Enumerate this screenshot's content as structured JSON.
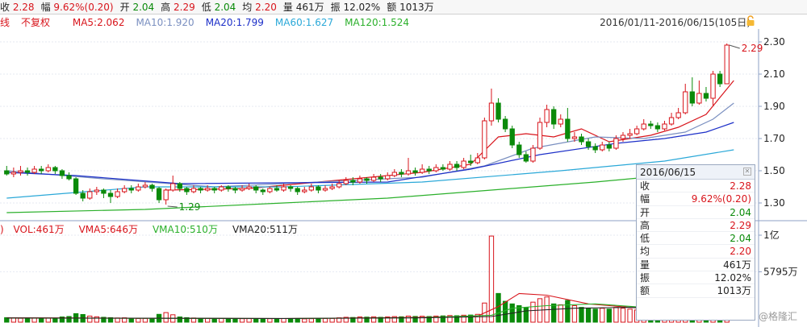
{
  "topbar": [
    {
      "label": "收",
      "value": "2.28",
      "tone": "red"
    },
    {
      "label": "幅",
      "value": "9.62%(0.20)",
      "tone": "red"
    },
    {
      "label": "开",
      "value": "2.04",
      "tone": "green"
    },
    {
      "label": "高",
      "value": "2.29",
      "tone": "red"
    },
    {
      "label": "低",
      "value": "2.04",
      "tone": "green"
    },
    {
      "label": "均",
      "value": "2.20",
      "tone": "red"
    },
    {
      "label": "量",
      "value": "461万",
      "tone": "dark"
    },
    {
      "label": "振",
      "value": "12.02%",
      "tone": "dark"
    },
    {
      "label": "额",
      "value": "1013万",
      "tone": "dark"
    }
  ],
  "ma_legend": {
    "prefix": "线",
    "mode": "不复权",
    "items": [
      {
        "text": "MA5:2.062",
        "color": "#d8141b"
      },
      {
        "text": "MA10:1.920",
        "color": "#7a8fc0"
      },
      {
        "text": "MA20:1.799",
        "color": "#1c2fc8"
      },
      {
        "text": "MA60:1.627",
        "color": "#2aa8d8"
      },
      {
        "text": "MA120:1.524",
        "color": "#2bb02b"
      }
    ]
  },
  "date_range": "2016/01/11-2016/06/15(105日)",
  "vol_legend": {
    "prefix": ")",
    "items": [
      {
        "text": "VOL:461万",
        "color": "#d8141b"
      },
      {
        "text": "VMA5:646万",
        "color": "#d8141b"
      },
      {
        "text": "VMA10:510万",
        "color": "#2bb02b"
      },
      {
        "text": "VMA20:511万",
        "color": "#222222"
      }
    ]
  },
  "infobox": {
    "date": "2016/06/15",
    "rows": [
      {
        "k": "收",
        "v": "2.28",
        "tone": "red"
      },
      {
        "k": "幅",
        "v": "9.62%(0.20)",
        "tone": "red"
      },
      {
        "k": "开",
        "v": "2.04",
        "tone": "green"
      },
      {
        "k": "高",
        "v": "2.29",
        "tone": "red"
      },
      {
        "k": "低",
        "v": "2.04",
        "tone": "green"
      },
      {
        "k": "均",
        "v": "2.20",
        "tone": "red"
      },
      {
        "k": "量",
        "v": "461万",
        "tone": "dark"
      },
      {
        "k": "振",
        "v": "12.02%",
        "tone": "dark"
      },
      {
        "k": "额",
        "v": "1013万",
        "tone": "dark"
      }
    ]
  },
  "watermark": "@格隆汇",
  "chart_data": {
    "type": "candlestick",
    "colors": {
      "up": "#d8141b",
      "down": "#0a8a0a"
    },
    "price_ticks": [
      "2.30",
      "2.10",
      "1.90",
      "1.70",
      "1.50",
      "1.30"
    ],
    "price_ylim": [
      1.22,
      2.36
    ],
    "volume_ticks": [
      "1亿",
      "5795万"
    ],
    "volume_ylim": [
      0,
      10000
    ],
    "annotations": [
      {
        "text": "2.29",
        "kind": "high"
      },
      {
        "text": "1.29",
        "kind": "low"
      }
    ],
    "candles": [
      [
        1.5,
        1.48,
        1.53,
        1.47
      ],
      [
        1.48,
        1.49,
        1.52,
        1.46
      ],
      [
        1.49,
        1.5,
        1.53,
        1.47
      ],
      [
        1.5,
        1.49,
        1.52,
        1.47
      ],
      [
        1.49,
        1.51,
        1.53,
        1.48
      ],
      [
        1.51,
        1.5,
        1.53,
        1.48
      ],
      [
        1.5,
        1.52,
        1.54,
        1.49
      ],
      [
        1.52,
        1.5,
        1.53,
        1.48
      ],
      [
        1.5,
        1.47,
        1.51,
        1.45
      ],
      [
        1.47,
        1.45,
        1.49,
        1.44
      ],
      [
        1.45,
        1.36,
        1.46,
        1.35
      ],
      [
        1.36,
        1.33,
        1.38,
        1.31
      ],
      [
        1.33,
        1.37,
        1.39,
        1.32
      ],
      [
        1.37,
        1.38,
        1.4,
        1.35
      ],
      [
        1.38,
        1.36,
        1.39,
        1.33
      ],
      [
        1.36,
        1.34,
        1.38,
        1.3
      ],
      [
        1.34,
        1.37,
        1.39,
        1.33
      ],
      [
        1.37,
        1.39,
        1.41,
        1.36
      ],
      [
        1.39,
        1.38,
        1.41,
        1.36
      ],
      [
        1.38,
        1.4,
        1.42,
        1.37
      ],
      [
        1.4,
        1.41,
        1.43,
        1.39
      ],
      [
        1.41,
        1.39,
        1.42,
        1.37
      ],
      [
        1.39,
        1.32,
        1.4,
        1.3
      ],
      [
        1.32,
        1.38,
        1.39,
        1.29
      ],
      [
        1.38,
        1.42,
        1.47,
        1.37
      ],
      [
        1.42,
        1.39,
        1.43,
        1.37
      ],
      [
        1.39,
        1.37,
        1.4,
        1.35
      ],
      [
        1.37,
        1.39,
        1.41,
        1.36
      ],
      [
        1.39,
        1.38,
        1.4,
        1.36
      ],
      [
        1.38,
        1.39,
        1.41,
        1.37
      ],
      [
        1.39,
        1.38,
        1.4,
        1.36
      ],
      [
        1.38,
        1.4,
        1.41,
        1.37
      ],
      [
        1.4,
        1.39,
        1.41,
        1.37
      ],
      [
        1.39,
        1.38,
        1.4,
        1.36
      ],
      [
        1.38,
        1.39,
        1.41,
        1.37
      ],
      [
        1.39,
        1.4,
        1.42,
        1.38
      ],
      [
        1.4,
        1.38,
        1.41,
        1.36
      ],
      [
        1.38,
        1.37,
        1.39,
        1.35
      ],
      [
        1.37,
        1.39,
        1.4,
        1.36
      ],
      [
        1.39,
        1.38,
        1.41,
        1.37
      ],
      [
        1.38,
        1.4,
        1.42,
        1.37
      ],
      [
        1.4,
        1.39,
        1.41,
        1.37
      ],
      [
        1.39,
        1.37,
        1.4,
        1.35
      ],
      [
        1.37,
        1.38,
        1.4,
        1.36
      ],
      [
        1.38,
        1.4,
        1.42,
        1.37
      ],
      [
        1.4,
        1.38,
        1.41,
        1.36
      ],
      [
        1.38,
        1.39,
        1.41,
        1.37
      ],
      [
        1.39,
        1.4,
        1.42,
        1.38
      ],
      [
        1.4,
        1.42,
        1.44,
        1.39
      ],
      [
        1.42,
        1.44,
        1.46,
        1.41
      ],
      [
        1.44,
        1.43,
        1.46,
        1.41
      ],
      [
        1.43,
        1.45,
        1.47,
        1.42
      ],
      [
        1.45,
        1.44,
        1.46,
        1.42
      ],
      [
        1.44,
        1.46,
        1.48,
        1.43
      ],
      [
        1.46,
        1.45,
        1.48,
        1.43
      ],
      [
        1.45,
        1.47,
        1.49,
        1.44
      ],
      [
        1.47,
        1.49,
        1.51,
        1.46
      ],
      [
        1.49,
        1.48,
        1.51,
        1.46
      ],
      [
        1.48,
        1.5,
        1.58,
        1.47
      ],
      [
        1.5,
        1.49,
        1.52,
        1.47
      ],
      [
        1.49,
        1.51,
        1.54,
        1.48
      ],
      [
        1.51,
        1.5,
        1.53,
        1.48
      ],
      [
        1.5,
        1.52,
        1.54,
        1.49
      ],
      [
        1.52,
        1.51,
        1.54,
        1.5
      ],
      [
        1.51,
        1.54,
        1.56,
        1.5
      ],
      [
        1.54,
        1.52,
        1.56,
        1.5
      ],
      [
        1.52,
        1.56,
        1.58,
        1.51
      ],
      [
        1.56,
        1.55,
        1.6,
        1.53
      ],
      [
        1.55,
        1.58,
        1.61,
        1.54
      ],
      [
        1.58,
        1.81,
        1.83,
        1.57
      ],
      [
        1.81,
        1.92,
        2.01,
        1.78
      ],
      [
        1.92,
        1.82,
        1.95,
        1.8
      ],
      [
        1.82,
        1.76,
        1.84,
        1.74
      ],
      [
        1.76,
        1.66,
        1.78,
        1.64
      ],
      [
        1.66,
        1.6,
        1.68,
        1.58
      ],
      [
        1.6,
        1.56,
        1.62,
        1.55
      ],
      [
        1.56,
        1.64,
        1.66,
        1.55
      ],
      [
        1.64,
        1.8,
        1.83,
        1.63
      ],
      [
        1.8,
        1.88,
        1.91,
        1.77
      ],
      [
        1.88,
        1.79,
        1.9,
        1.76
      ],
      [
        1.79,
        1.82,
        1.85,
        1.77
      ],
      [
        1.82,
        1.7,
        1.89,
        1.68
      ],
      [
        1.7,
        1.71,
        1.74,
        1.68
      ],
      [
        1.71,
        1.68,
        1.73,
        1.66
      ],
      [
        1.68,
        1.65,
        1.7,
        1.63
      ],
      [
        1.65,
        1.63,
        1.67,
        1.61
      ],
      [
        1.63,
        1.66,
        1.68,
        1.62
      ],
      [
        1.66,
        1.64,
        1.68,
        1.62
      ],
      [
        1.64,
        1.7,
        1.72,
        1.63
      ],
      [
        1.7,
        1.72,
        1.74,
        1.68
      ],
      [
        1.72,
        1.73,
        1.76,
        1.7
      ],
      [
        1.73,
        1.76,
        1.78,
        1.72
      ],
      [
        1.76,
        1.79,
        1.82,
        1.75
      ],
      [
        1.79,
        1.78,
        1.81,
        1.76
      ],
      [
        1.78,
        1.76,
        1.8,
        1.74
      ],
      [
        1.76,
        1.79,
        1.81,
        1.75
      ],
      [
        1.79,
        1.83,
        1.86,
        1.78
      ],
      [
        1.83,
        1.86,
        1.89,
        1.82
      ],
      [
        1.86,
        1.99,
        2.04,
        1.85
      ],
      [
        1.99,
        1.92,
        2.08,
        1.9
      ],
      [
        1.92,
        1.98,
        2.06,
        1.91
      ],
      [
        1.98,
        1.95,
        2.02,
        1.93
      ],
      [
        1.95,
        2.1,
        2.12,
        1.9
      ],
      [
        2.1,
        2.04,
        2.12,
        2.02
      ],
      [
        2.04,
        2.28,
        2.29,
        2.04
      ]
    ],
    "volumes": [
      520,
      480,
      450,
      500,
      470,
      430,
      460,
      410,
      600,
      650,
      980,
      880,
      700,
      620,
      560,
      520,
      480,
      500,
      450,
      420,
      430,
      400,
      900,
      1100,
      850,
      600,
      520,
      480,
      450,
      430,
      410,
      420,
      400,
      380,
      400,
      410,
      390,
      380,
      400,
      410,
      420,
      400,
      390,
      380,
      400,
      410,
      420,
      430,
      500,
      560,
      540,
      600,
      580,
      620,
      560,
      600,
      640,
      620,
      700,
      660,
      680,
      650,
      700,
      720,
      760,
      740,
      800,
      820,
      900,
      2200,
      9900,
      3300,
      2400,
      2100,
      1900,
      1700,
      2300,
      2700,
      2900,
      2100,
      2000,
      2500,
      1900,
      1700,
      1600,
      1500,
      1600,
      1500,
      1700,
      1600,
      1500,
      1400,
      1300,
      1200,
      1100,
      1000,
      900,
      1100,
      900,
      1300,
      1100,
      1000,
      950,
      700,
      461
    ],
    "ma_series": [
      {
        "name": "MA5",
        "color": "#d8141b",
        "values": [
          [
            23,
            1.38
          ],
          [
            35,
            1.39
          ],
          [
            60,
            1.49
          ],
          [
            67,
            1.54
          ],
          [
            71,
            1.71
          ],
          [
            75,
            1.73
          ],
          [
            79,
            1.71
          ],
          [
            83,
            1.76
          ],
          [
            87,
            1.68
          ],
          [
            93,
            1.72
          ],
          [
            97,
            1.77
          ],
          [
            101,
            1.85
          ],
          [
            105,
            2.06
          ]
        ]
      },
      {
        "name": "MA10",
        "color": "#7a8fc0",
        "values": [
          [
            0,
            1.5
          ],
          [
            14,
            1.45
          ],
          [
            30,
            1.4
          ],
          [
            60,
            1.46
          ],
          [
            69,
            1.53
          ],
          [
            76,
            1.64
          ],
          [
            85,
            1.71
          ],
          [
            92,
            1.7
          ],
          [
            98,
            1.74
          ],
          [
            102,
            1.82
          ],
          [
            105,
            1.92
          ]
        ]
      },
      {
        "name": "MA20",
        "color": "#1c2fc8",
        "values": [
          [
            0,
            1.49
          ],
          [
            10,
            1.47
          ],
          [
            25,
            1.42
          ],
          [
            55,
            1.43
          ],
          [
            67,
            1.51
          ],
          [
            77,
            1.6
          ],
          [
            88,
            1.67
          ],
          [
            95,
            1.7
          ],
          [
            101,
            1.74
          ],
          [
            105,
            1.8
          ]
        ]
      },
      {
        "name": "MA60",
        "color": "#2aa8d8",
        "values": [
          [
            0,
            1.33
          ],
          [
            20,
            1.4
          ],
          [
            40,
            1.4
          ],
          [
            60,
            1.43
          ],
          [
            80,
            1.5
          ],
          [
            95,
            1.56
          ],
          [
            105,
            1.63
          ]
        ]
      },
      {
        "name": "MA120",
        "color": "#2bb02b",
        "values": [
          [
            0,
            1.24
          ],
          [
            20,
            1.26
          ],
          [
            40,
            1.3
          ],
          [
            55,
            1.33
          ],
          [
            70,
            1.38
          ],
          [
            85,
            1.43
          ],
          [
            100,
            1.49
          ],
          [
            105,
            1.52
          ]
        ]
      }
    ],
    "vma_series": [
      {
        "name": "VMA5",
        "color": "#d8141b",
        "values": [
          [
            0,
            500
          ],
          [
            40,
            420
          ],
          [
            60,
            560
          ],
          [
            68,
            700
          ],
          [
            71,
            1800
          ],
          [
            74,
            3300
          ],
          [
            78,
            3100
          ],
          [
            84,
            2100
          ],
          [
            90,
            1700
          ],
          [
            96,
            1300
          ],
          [
            102,
            1000
          ],
          [
            105,
            646
          ]
        ]
      },
      {
        "name": "VMA10",
        "color": "#2bb02b",
        "values": [
          [
            0,
            470
          ],
          [
            40,
            420
          ],
          [
            60,
            520
          ],
          [
            70,
            800
          ],
          [
            73,
            1600
          ],
          [
            78,
            1900
          ],
          [
            85,
            2100
          ],
          [
            92,
            1700
          ],
          [
            99,
            1200
          ],
          [
            105,
            510
          ]
        ]
      },
      {
        "name": "VMA20",
        "color": "#222222",
        "values": [
          [
            0,
            480
          ],
          [
            40,
            430
          ],
          [
            60,
            500
          ],
          [
            70,
            650
          ],
          [
            75,
            1300
          ],
          [
            82,
            1600
          ],
          [
            90,
            1700
          ],
          [
            97,
            1400
          ],
          [
            103,
            1000
          ],
          [
            105,
            511
          ]
        ]
      }
    ]
  }
}
